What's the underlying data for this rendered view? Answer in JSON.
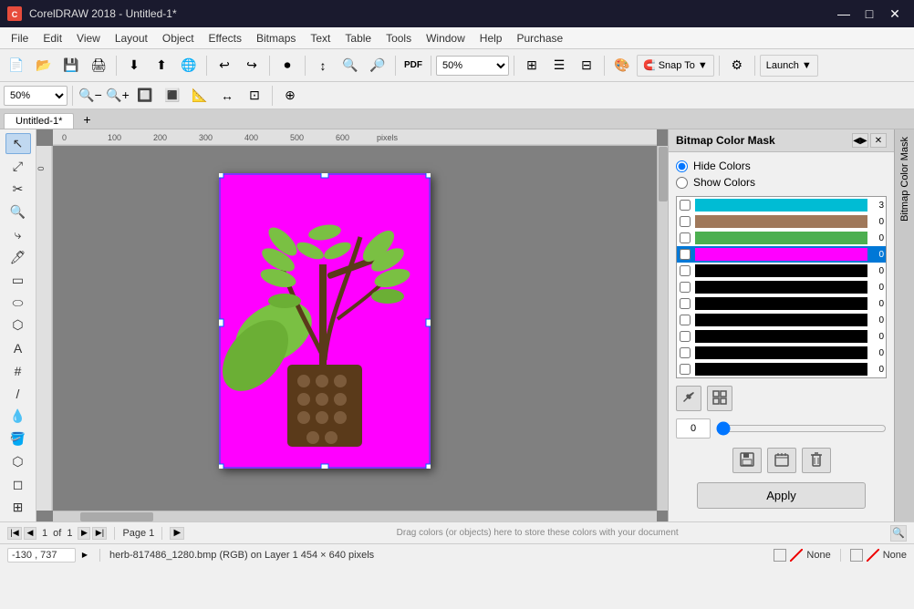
{
  "titleBar": {
    "appName": "CorelDRAW 2018 - Untitled-1*",
    "minimize": "—",
    "maximize": "□",
    "close": "✕"
  },
  "menuBar": {
    "items": [
      "File",
      "Edit",
      "View",
      "Layout",
      "Object",
      "Effects",
      "Bitmaps",
      "Text",
      "Table",
      "Tools",
      "Window",
      "Help",
      "Purchase"
    ]
  },
  "toolbar": {
    "zoomLevel": "50%",
    "snapLabel": "Snap To",
    "launchLabel": "Launch"
  },
  "toolbar2": {
    "zoomLevel": "50%"
  },
  "tabs": {
    "pages": [
      "Untitled-1*"
    ],
    "addLabel": "+"
  },
  "pageStatus": {
    "current": "1",
    "total": "1",
    "pageName": "Page 1"
  },
  "dragHint": "Drag colors (or objects) here to store these colors with your document",
  "bottomStatus": {
    "coords": "-130 , 737",
    "fileInfo": "herb-817486_1280.bmp (RGB) on Layer 1 454 × 640 pixels",
    "fill": "None",
    "outline": "None"
  },
  "bitmapColorMask": {
    "title": "Bitmap Color Mask",
    "hideColors": "Hide Colors",
    "showColors": "Show Colors",
    "colors": [
      {
        "hex": "#00bcd4",
        "count": "3",
        "selected": false
      },
      {
        "hex": "#a0785a",
        "count": "0",
        "selected": false
      },
      {
        "hex": "#4caf50",
        "count": "0",
        "selected": false
      },
      {
        "hex": "#ff00ff",
        "count": "0",
        "selected": true
      },
      {
        "hex": "#000000",
        "count": "0",
        "selected": false
      },
      {
        "hex": "#000000",
        "count": "0",
        "selected": false
      },
      {
        "hex": "#000000",
        "count": "0",
        "selected": false
      },
      {
        "hex": "#000000",
        "count": "0",
        "selected": false
      },
      {
        "hex": "#000000",
        "count": "0",
        "selected": false
      },
      {
        "hex": "#000000",
        "count": "0",
        "selected": false
      },
      {
        "hex": "#000000",
        "count": "0",
        "selected": false
      }
    ],
    "toleranceValue": "0",
    "applyLabel": "Apply"
  }
}
